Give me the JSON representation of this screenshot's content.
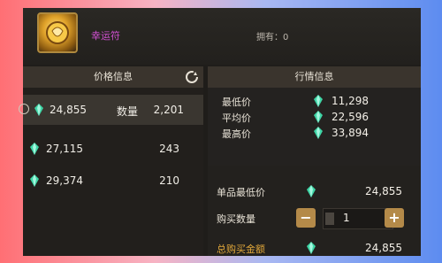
{
  "header": {
    "item_name": "幸运符",
    "owned_text": "拥有：0"
  },
  "price_panel": {
    "title": "价格信息",
    "rows": [
      {
        "price": "24,855",
        "qty_label": "数量",
        "qty": "2,201",
        "selected": true
      },
      {
        "price": "27,115",
        "qty": "243"
      },
      {
        "price": "29,374",
        "qty": "210"
      }
    ]
  },
  "market_panel": {
    "title": "行情信息",
    "stats": [
      {
        "label": "最低价",
        "value": "11,298"
      },
      {
        "label": "平均价",
        "value": "22,596"
      },
      {
        "label": "最高价",
        "value": "33,894"
      }
    ]
  },
  "purchase": {
    "unit_min_label": "单品最低价",
    "unit_min_value": "24,855",
    "qty_label": "购买数量",
    "qty_value": "1",
    "minus_label": "−",
    "plus_label": "+",
    "total_label": "总购买金额",
    "total_value": "24,855"
  },
  "colors": {
    "gem": "#3fd6a6",
    "accent_gold": "#b48a49",
    "item_name": "#d050d0"
  }
}
